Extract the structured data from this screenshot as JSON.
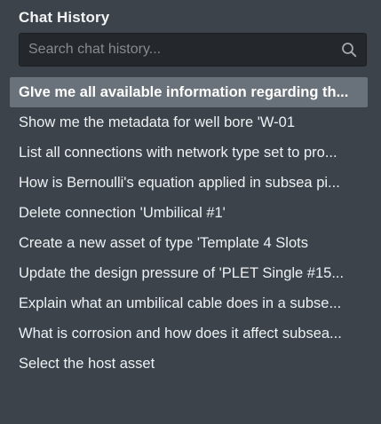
{
  "panel": {
    "title": "Chat History"
  },
  "search": {
    "placeholder": "Search chat history...",
    "value": "",
    "icon": "search-icon"
  },
  "history": {
    "active_index": 0,
    "items": [
      {
        "label": "GIve me all available information regarding th..."
      },
      {
        "label": "Show me the metadata for well bore 'W-01"
      },
      {
        "label": "List all connections with network type set to pro..."
      },
      {
        "label": "How is Bernoulli's equation applied in subsea pi..."
      },
      {
        "label": "Delete connection 'Umbilical #1'"
      },
      {
        "label": "Create a new asset of type 'Template 4 Slots"
      },
      {
        "label": "Update the design pressure of 'PLET Single #15..."
      },
      {
        "label": "Explain what an umbilical cable does in a subse..."
      },
      {
        "label": "What is corrosion and how does it affect subsea..."
      },
      {
        "label": "Select the host asset"
      }
    ]
  },
  "colors": {
    "panel_background": "#3c434b",
    "search_background": "#24282c",
    "active_item_background": "#69717a",
    "text": "#eef1f3"
  }
}
